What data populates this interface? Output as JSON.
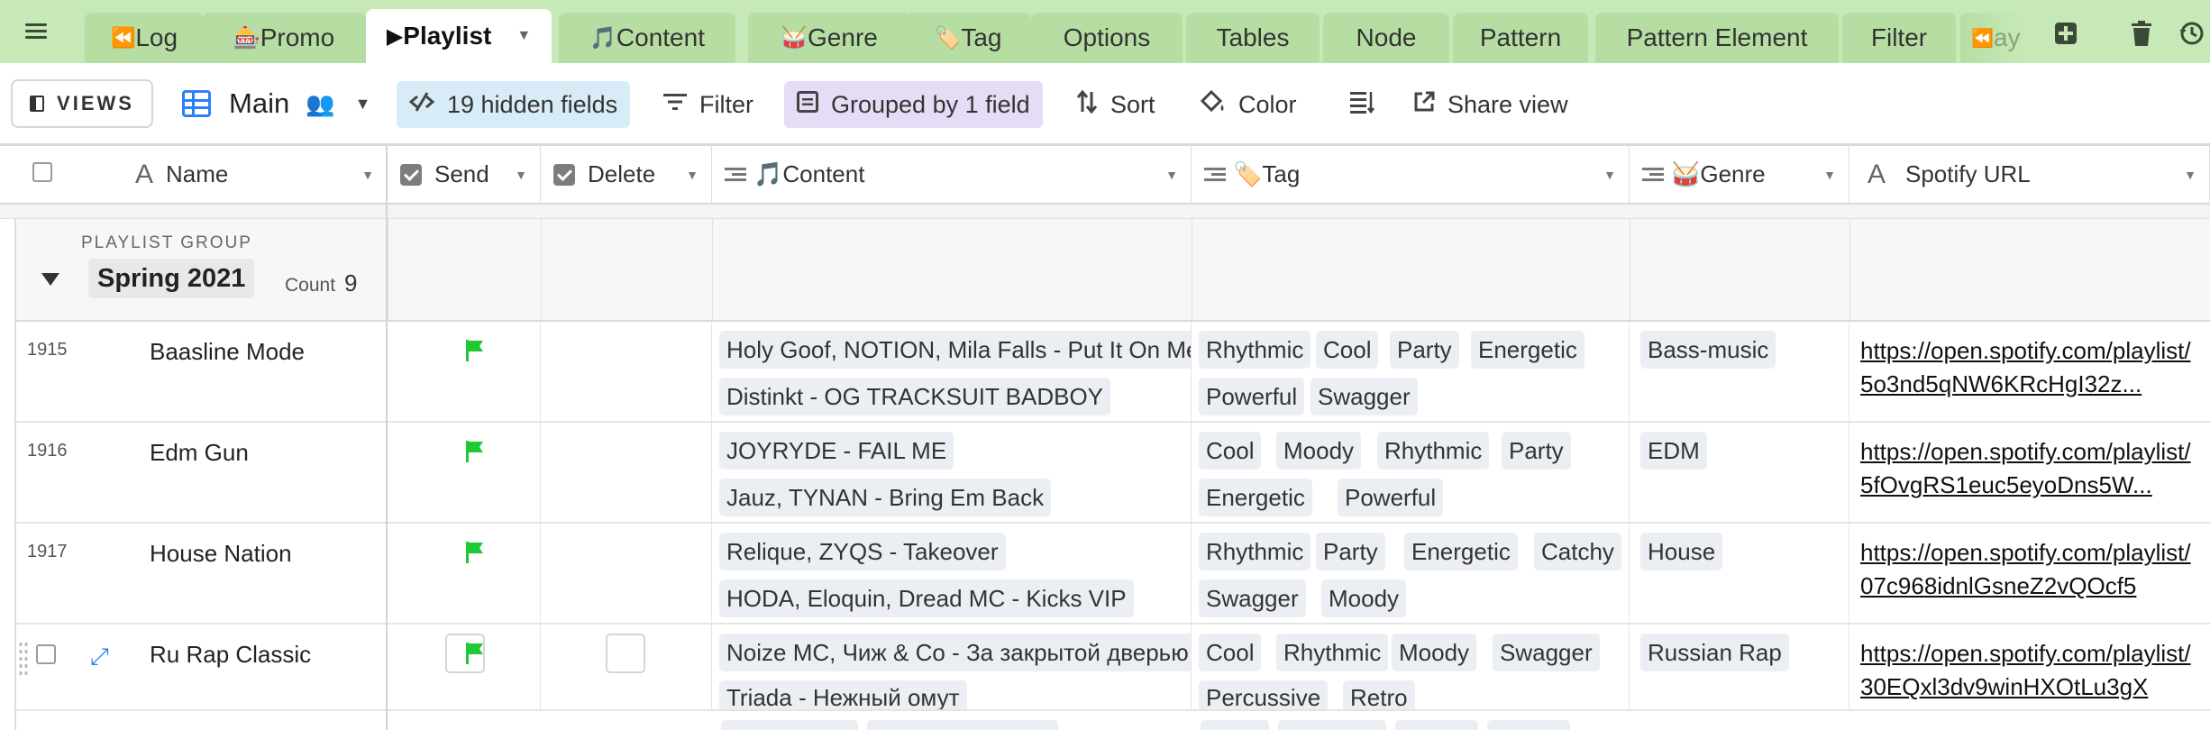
{
  "tabs": [
    {
      "label": "Log",
      "icon": "⏪"
    },
    {
      "label": "Promo",
      "icon": "🎰"
    },
    {
      "label": "Playlist",
      "icon": "▶",
      "active": true
    },
    {
      "label": "Content",
      "icon": "🎵"
    },
    {
      "label": "Genre",
      "icon": "🥁"
    },
    {
      "label": "Tag",
      "icon": "🏷️"
    },
    {
      "label": "Options"
    },
    {
      "label": "Tables"
    },
    {
      "label": "Node"
    },
    {
      "label": "Pattern"
    },
    {
      "label": "Pattern Element"
    },
    {
      "label": "Filter"
    }
  ],
  "tab_overflow": "ay",
  "toolbar": {
    "views_label": "VIEWS",
    "view_name": "Main",
    "hidden_fields": "19 hidden fields",
    "filter": "Filter",
    "grouped": "Grouped by 1 field",
    "sort": "Sort",
    "color": "Color",
    "share": "Share view"
  },
  "columns": {
    "name": "Name",
    "send": "Send",
    "delete": "Delete",
    "content": "🎵Content",
    "tag": "🏷️Tag",
    "genre": "🥁Genre",
    "spotify": "Spotify URL"
  },
  "group": {
    "label": "PLAYLIST GROUP",
    "value": "Spring 2021",
    "count_label": "Count",
    "count": "9"
  },
  "rows": [
    {
      "id": "1915",
      "name": "Baasline Mode",
      "send": true,
      "content": [
        "Holy Goof, NOTION, Mila Falls - Put It On Me",
        "Distinkt - OG TRACKSUIT BADBOY"
      ],
      "tags": [
        "Rhythmic",
        "Cool",
        "Party",
        "Energetic",
        "Powerful",
        "Swagger"
      ],
      "genre": "Bass-music",
      "url": "https://open.spotify.com/playlist/5o3nd5qNW6KRcHgI32z..."
    },
    {
      "id": "1916",
      "name": "Edm Gun",
      "send": true,
      "content": [
        "JOYRYDE - FAIL ME",
        "Jauz, TYNAN - Bring Em Back"
      ],
      "tags": [
        "Cool",
        "Moody",
        "Rhythmic",
        "Party",
        "Energetic",
        "Powerful"
      ],
      "genre": "EDM",
      "url": "https://open.spotify.com/playlist/5fOvgRS1euc5eyoDns5W..."
    },
    {
      "id": "1917",
      "name": "House Nation",
      "send": true,
      "content": [
        "Relique, ZYQS - Takeover",
        "HODA, Eloquin, Dread MC - Kicks VIP"
      ],
      "tags": [
        "Rhythmic",
        "Party",
        "Energetic",
        "Catchy",
        "Swagger",
        "Moody"
      ],
      "genre": "House",
      "url": "https://open.spotify.com/playlist/07c968idnlGsneZ2vQOcf5"
    },
    {
      "id": "",
      "name": "Ru Rap Classic",
      "send": true,
      "content": [
        "Noize MC, Чиж & Co - За закрытой дверью",
        "Triada - Нежный омут"
      ],
      "tags": [
        "Cool",
        "Rhythmic",
        "Moody",
        "Swagger",
        "Percussive",
        "Retro"
      ],
      "genre": "Russian Rap",
      "url": "https://open.spotify.com/playlist/30EQxl3dv9winHXOtLu3gX"
    }
  ],
  "colors": {
    "tabbar": "#c7e9b7",
    "tab": "#b6dea2",
    "accent": "#2d7ff9",
    "flag": "#20c933",
    "chip": "#ebeef3"
  }
}
